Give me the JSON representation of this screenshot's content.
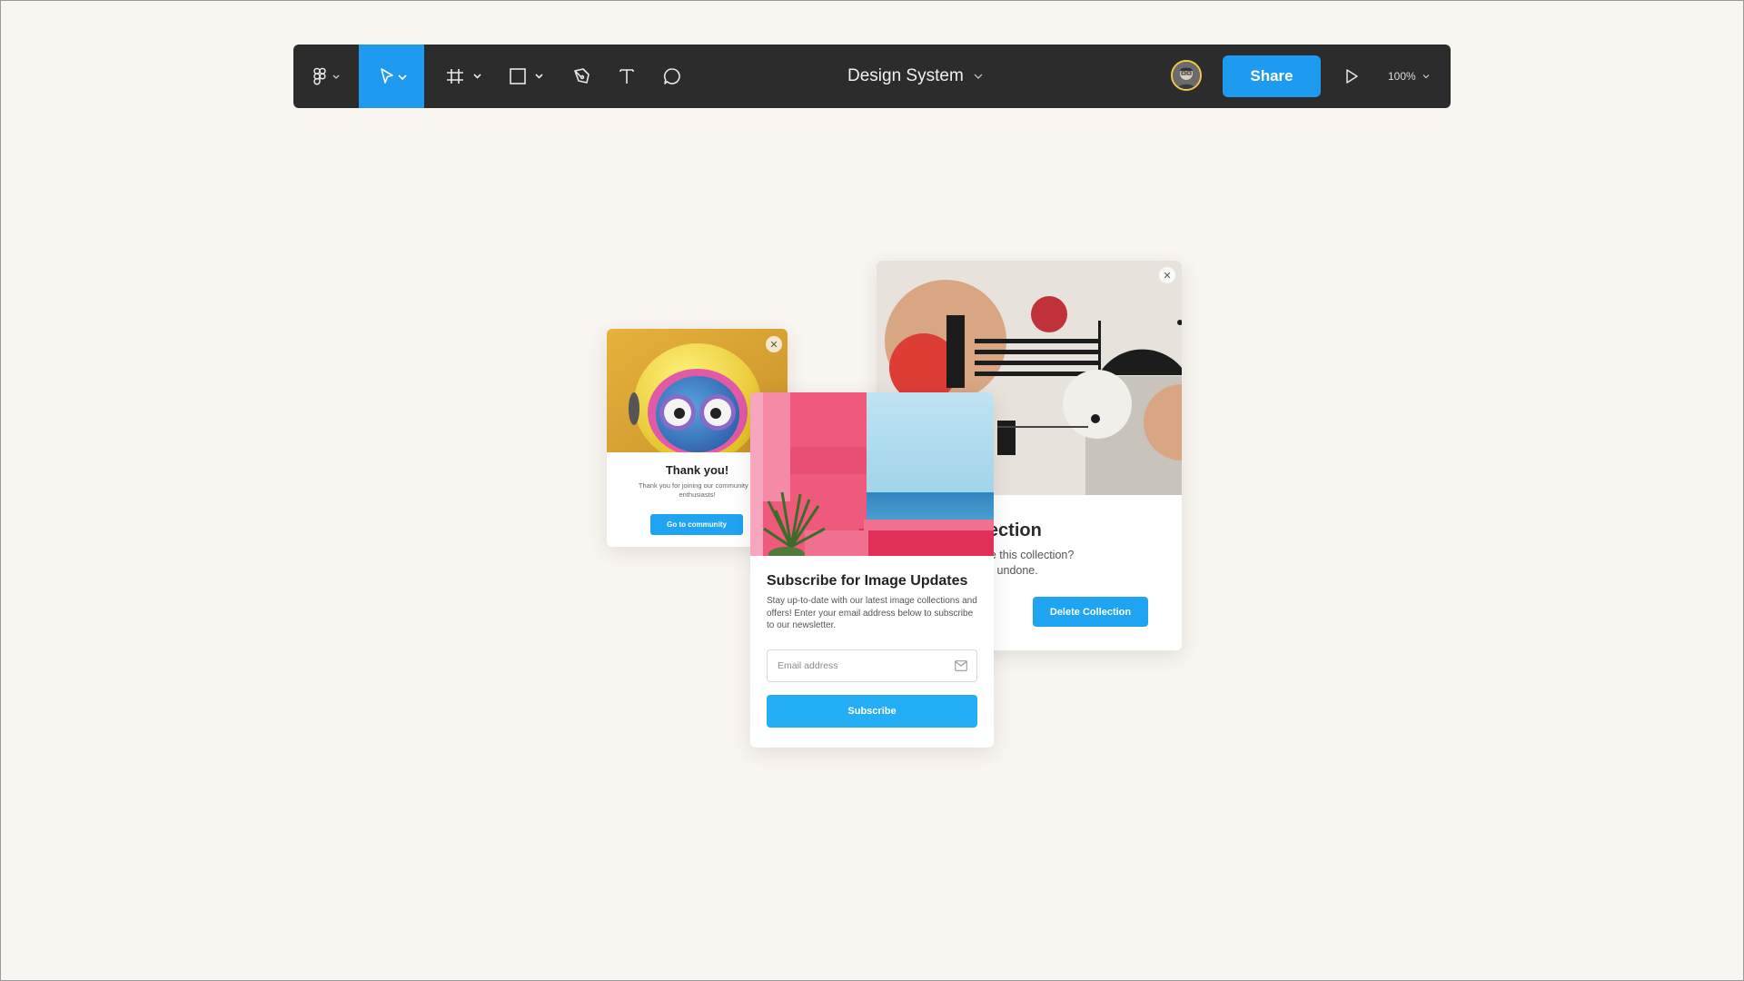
{
  "toolbar": {
    "file_title": "Design System",
    "share_label": "Share",
    "zoom": "100%",
    "tools": [
      "figma-menu",
      "move",
      "frame",
      "shape",
      "pen",
      "text",
      "comment"
    ],
    "accent": "#1e9bf0",
    "bg": "#2c2c2c"
  },
  "thank_card": {
    "title": "Thank you!",
    "text": "Thank you for joining our community of enthusiasts!",
    "button": "Go to community"
  },
  "delete_card": {
    "title": "ete collection",
    "text_line1": "want to delete this collection?",
    "text_line2": "ion cannot be undone.",
    "button": "Delete Collection"
  },
  "subscribe_card": {
    "title": "Subscribe for Image Updates",
    "text": "Stay up-to-date with our latest image collections and offers! Enter your email address below to subscribe to our newsletter.",
    "email_placeholder": "Email address",
    "button": "Subscribe"
  },
  "canvas_bg": "#f9f5f0"
}
